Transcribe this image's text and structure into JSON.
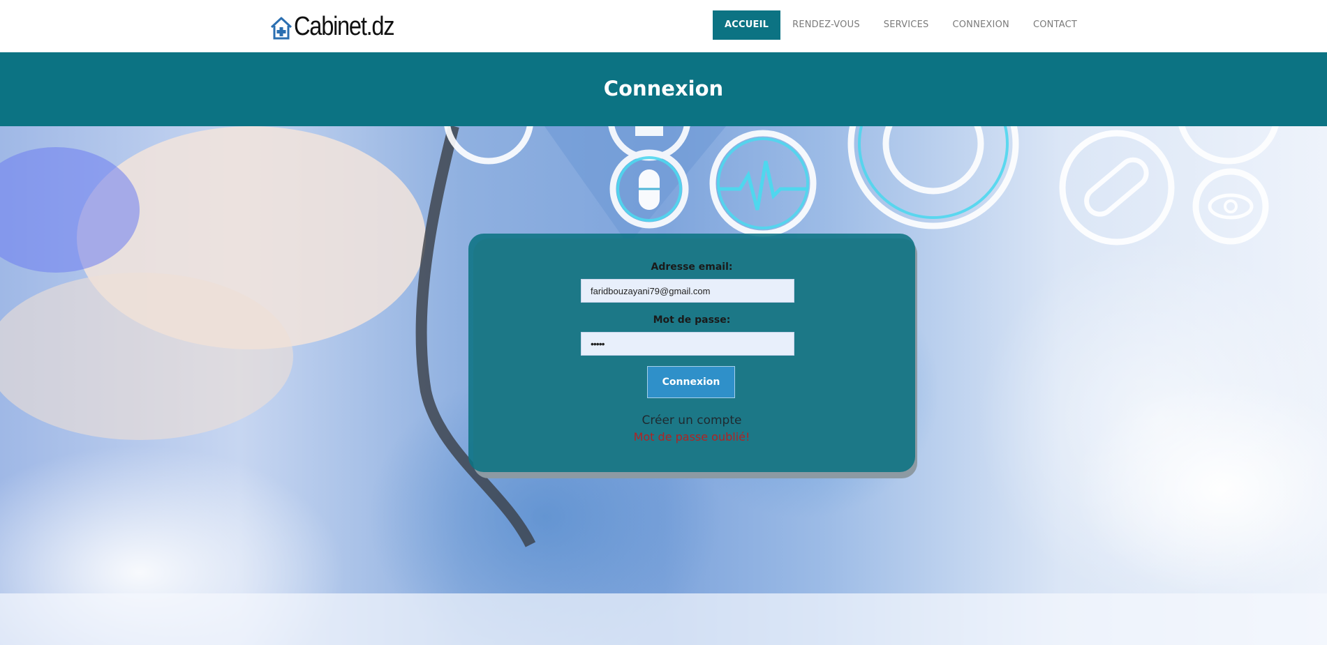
{
  "brand": {
    "name": "Cabinet.dz",
    "logo_icon": "house-plus-icon"
  },
  "nav": {
    "items": [
      {
        "label": "ACCUEIL",
        "active": true
      },
      {
        "label": "RENDEZ-VOUS",
        "active": false
      },
      {
        "label": "SERVICES",
        "active": false
      },
      {
        "label": "CONNEXION",
        "active": false
      },
      {
        "label": "CONTACT",
        "active": false
      }
    ]
  },
  "page": {
    "title": "Connexion"
  },
  "login": {
    "email_label": "Adresse email:",
    "email_value": "faridbouzayani79@gmail.com",
    "password_label": "Mot de passe:",
    "password_value": "•••••",
    "submit_label": "Connexion",
    "create_account": "Créer un compte",
    "forgot_password": "Mot de passe oublié!"
  },
  "colors": {
    "accent": "#0c7383",
    "button": "#2f90c9",
    "forgot_link": "#b02323",
    "field_bg": "#e8effb"
  }
}
